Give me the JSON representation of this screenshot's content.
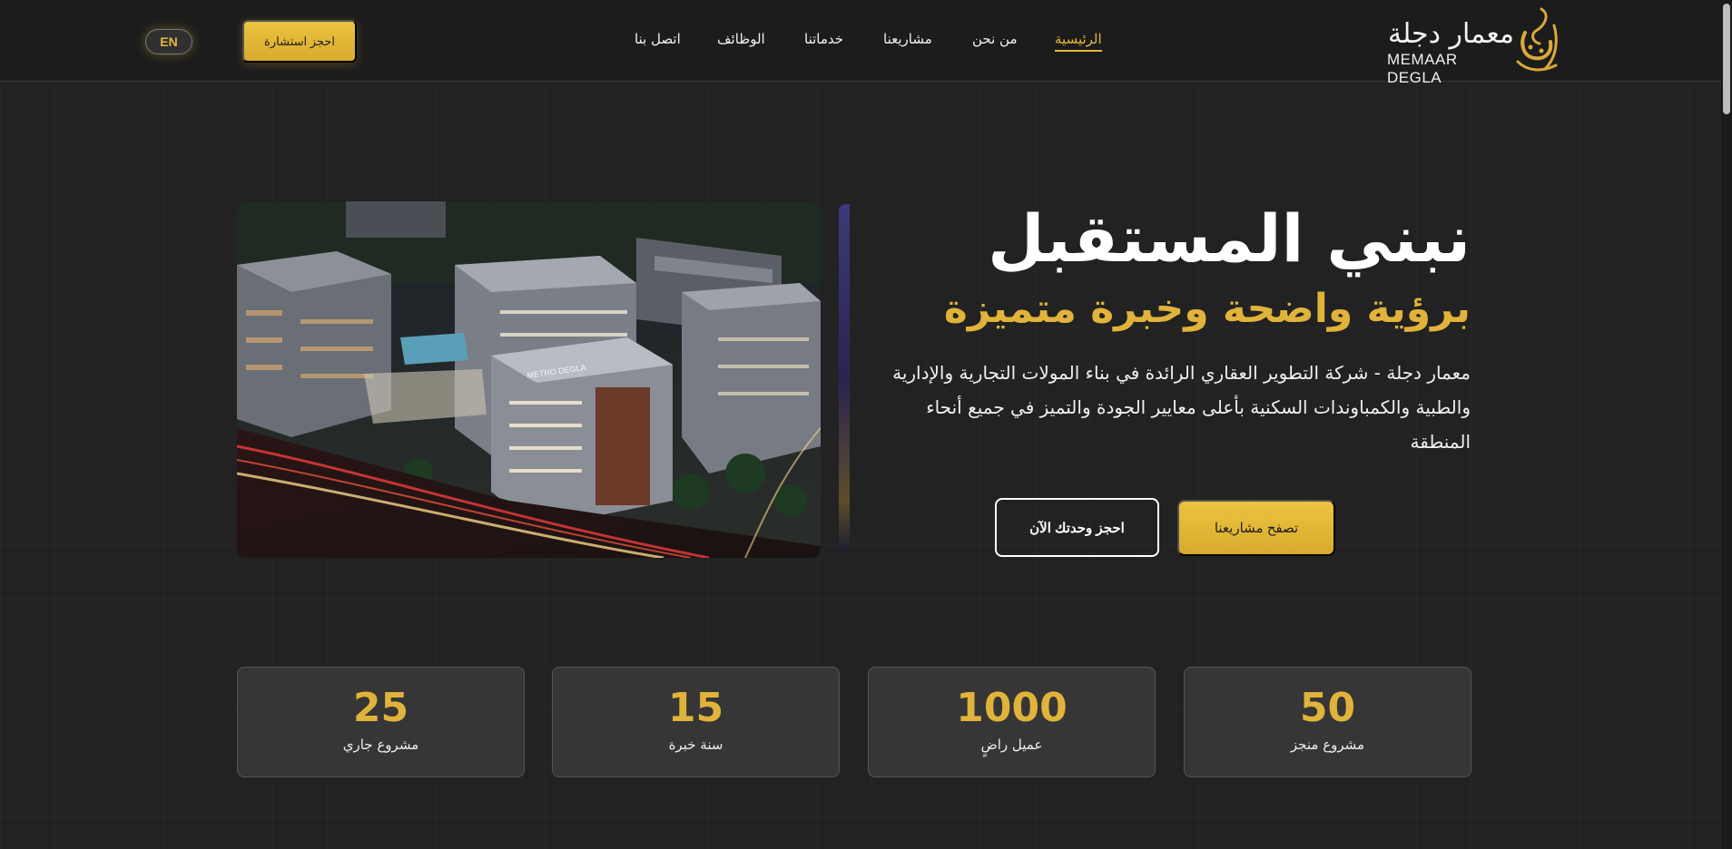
{
  "brand": {
    "name_ar": "معمار دجلة",
    "name_en": "MEMAAR DEGLA",
    "logo_icon": "calligraphy-mark-icon",
    "accent": "#e4b93a"
  },
  "nav": {
    "items": [
      {
        "label": "الرئيسية",
        "active": true
      },
      {
        "label": "من نحن",
        "active": false
      },
      {
        "label": "مشاريعنا",
        "active": false
      },
      {
        "label": "خدماتنا",
        "active": false
      },
      {
        "label": "الوظائف",
        "active": false
      },
      {
        "label": "اتصل بنا",
        "active": false
      }
    ],
    "consult_label": "احجز استشارة",
    "lang_label": "EN"
  },
  "hero": {
    "title": "نبني المستقبل",
    "subtitle": "برؤية واضحة وخبرة متميزة",
    "description": "معمار دجلة - شركة التطوير العقاري الرائدة في بناء المولات التجارية والإدارية والطبية والكمباوندات السكنية بأعلى معايير الجودة والتميز في جميع أنحاء المنطقة",
    "primary_button": "تصفح مشاريعنا",
    "secondary_button": "احجز وحدتك الآن",
    "image_sign": "METRO DEGLA"
  },
  "stats": [
    {
      "number": "50",
      "label": "مشروع منجز"
    },
    {
      "number": "1000",
      "label": "عميل راضٍ"
    },
    {
      "number": "15",
      "label": "سنة خبرة"
    },
    {
      "number": "25",
      "label": "مشروع جاري"
    }
  ]
}
